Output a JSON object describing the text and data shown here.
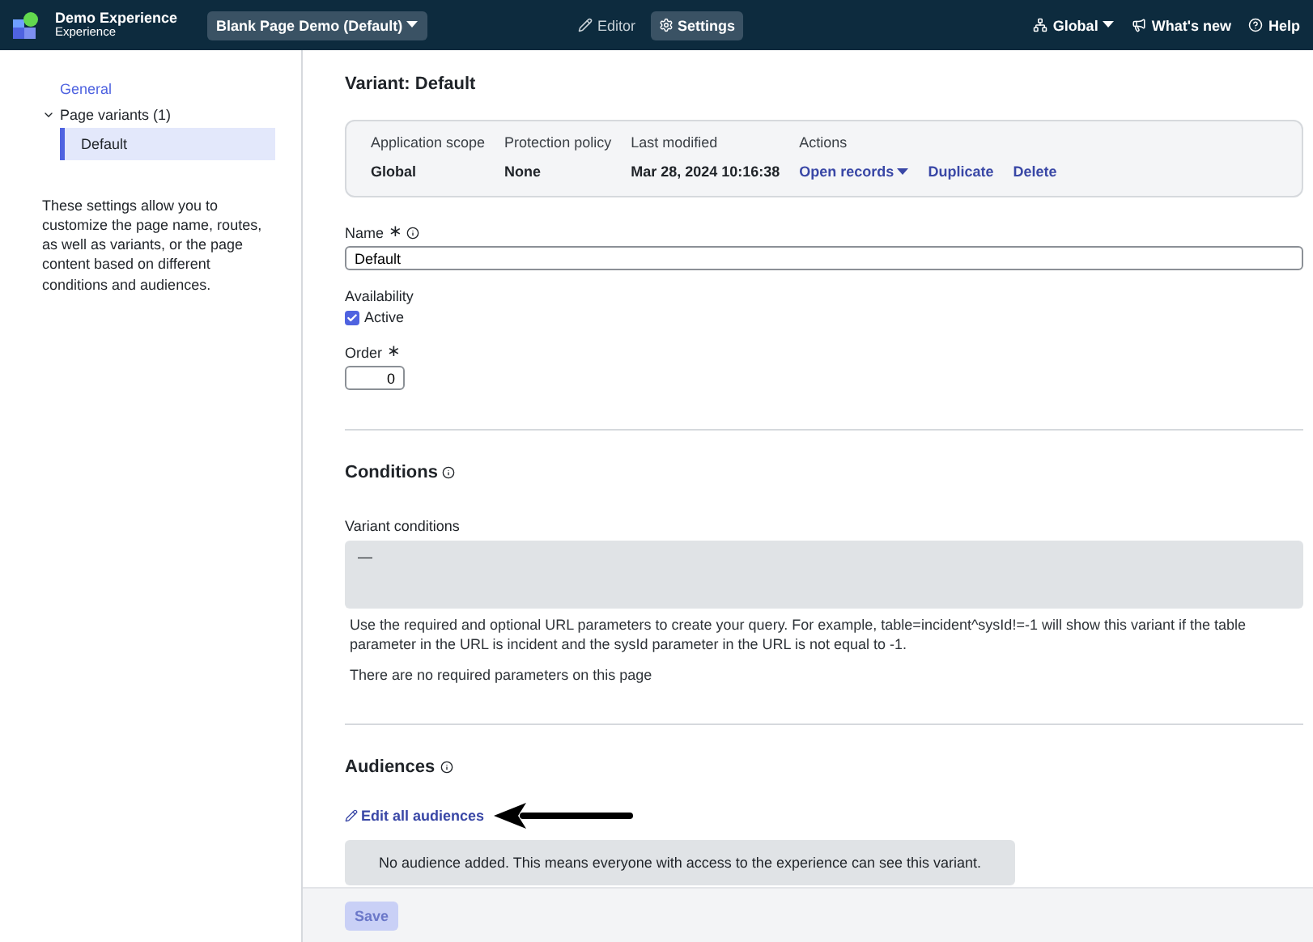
{
  "header": {
    "app_title": "Demo Experience",
    "app_subtitle": "Experience",
    "page_selector": "Blank Page Demo (Default)",
    "tabs": [
      {
        "label": "Editor",
        "kind": "edit",
        "selected": false
      },
      {
        "label": "Settings",
        "kind": "gear",
        "selected": true
      }
    ],
    "scope": "Global",
    "whats_new": "What's new",
    "help": "Help"
  },
  "sidebar": {
    "items": [
      {
        "label": "General",
        "selected": false
      },
      {
        "label": "Page variants (1)",
        "expanded": true,
        "selected": false,
        "children": [
          {
            "label": "Default",
            "selected": true
          }
        ]
      }
    ],
    "description": "These settings allow you to customize the page name, routes, as well as variants, or the page content based on different conditions and audiences."
  },
  "variant": {
    "title": "Variant: Default",
    "info": [
      {
        "label": "Application scope",
        "value": "Global"
      },
      {
        "label": "Protection policy",
        "value": "None"
      },
      {
        "label": "Last modified",
        "value": "Mar 28, 2024 10:16:38"
      }
    ],
    "actions_label": "Actions",
    "actions": [
      {
        "label": "Open records",
        "kind": "dropdown"
      },
      {
        "label": "Duplicate",
        "kind": "link"
      },
      {
        "label": "Delete",
        "kind": "link"
      }
    ],
    "name": {
      "label": "Name",
      "required_mark": "∗",
      "value": "Default"
    },
    "availability": {
      "label": "Availability",
      "option": "Active",
      "checked": true
    },
    "order": {
      "label": "Order",
      "required_mark": "∗",
      "value": "0"
    }
  },
  "conditions": {
    "title": "Conditions",
    "field_label": "Variant conditions",
    "value": "—",
    "help": "Use the required and optional URL parameters to create your query. For example, table=incident^sysId!=-1 will show this variant if the table parameter in the URL is incident and the sysId parameter in the URL is not equal to -1.",
    "note": "There are no required parameters on this page"
  },
  "audiences": {
    "title": "Audiences",
    "edit_link": "Edit all audiences",
    "empty": "No audience added. This means everyone with access to the experience can see this variant."
  },
  "save": {
    "label": "Save",
    "disabled": true
  }
}
